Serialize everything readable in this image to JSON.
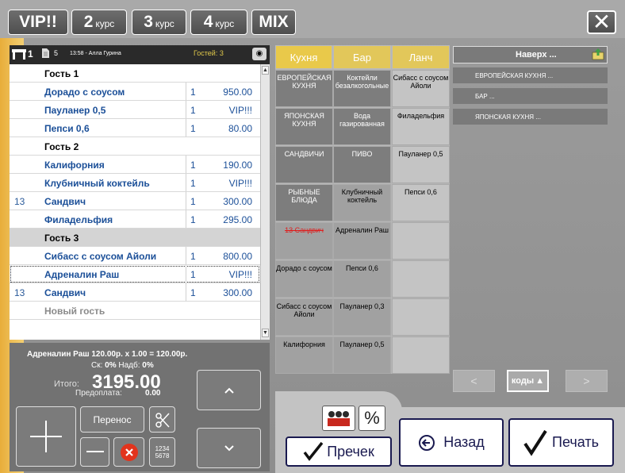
{
  "topbar": {
    "buttons": [
      {
        "big": "VIP!!",
        "small": ""
      },
      {
        "big": "2",
        "small": "курс"
      },
      {
        "big": "3",
        "small": "курс"
      },
      {
        "big": "4",
        "small": "курс"
      },
      {
        "big": "MIX",
        "small": ""
      }
    ],
    "close_label": "✕"
  },
  "order_header": {
    "table": "1",
    "order_count": "5",
    "time_waiter": "13:58 - Алла Гурина",
    "guests": "Гостей: 3"
  },
  "order_rows": [
    {
      "num": "",
      "name": "Гость 1",
      "qty": "",
      "price": "",
      "kind": "guest"
    },
    {
      "num": "",
      "name": "Дорадо с соусом",
      "qty": "1",
      "price": "950.00",
      "kind": "item"
    },
    {
      "num": "",
      "name": "Пауланер 0,5",
      "qty": "1",
      "price": "VIP!!!",
      "kind": "item"
    },
    {
      "num": "",
      "name": "Пепси 0,6",
      "qty": "1",
      "price": "80.00",
      "kind": "item"
    },
    {
      "num": "",
      "name": "Гость 2",
      "qty": "",
      "price": "",
      "kind": "guest"
    },
    {
      "num": "",
      "name": "Калифорния",
      "qty": "1",
      "price": "190.00",
      "kind": "item"
    },
    {
      "num": "",
      "name": "Клубничный коктейль",
      "qty": "1",
      "price": "VIP!!!",
      "kind": "item"
    },
    {
      "num": "13",
      "name": "Сандвич",
      "qty": "1",
      "price": "300.00",
      "kind": "item"
    },
    {
      "num": "",
      "name": "Филадельфия",
      "qty": "1",
      "price": "295.00",
      "kind": "item"
    },
    {
      "num": "",
      "name": "Гость 3",
      "qty": "",
      "price": "",
      "kind": "guestgray"
    },
    {
      "num": "",
      "name": "Сибасс с соусом Айоли",
      "qty": "1",
      "price": "800.00",
      "kind": "item"
    },
    {
      "num": "",
      "name": "Адреналин Раш",
      "qty": "1",
      "price": "VIP!!!",
      "kind": "sel"
    },
    {
      "num": "13",
      "name": "Сандвич",
      "qty": "1",
      "price": "300.00",
      "kind": "item"
    },
    {
      "num": "",
      "name": "Новый гость",
      "qty": "",
      "price": "",
      "kind": "newguest"
    }
  ],
  "summary": {
    "line": "Адреналин Раш 120.00р. x 1.00 = 120.00р.",
    "discount_label": "Ск:",
    "discount_value": "0%",
    "markup_label": "Надб:",
    "markup_value": "0%",
    "total_label": "Итого:",
    "total_value": "3195.00",
    "prepay_label": "Предоплата:",
    "prepay_value": "0.00"
  },
  "left_controls": {
    "transfer": "Перенос",
    "keypad_top": "1234",
    "keypad_bottom": "5678"
  },
  "categories": [
    "Кухня",
    "Бар",
    "Ланч"
  ],
  "grid_columns": [
    [
      "ЕВРОПЕЙСКАЯ КУХНЯ",
      "ЯПОНСКАЯ КУХНЯ",
      "САНДВИЧИ",
      "РЫБНЫЕ БЛЮДА",
      "13  Сандвич",
      "Дорадо с соусом",
      "Сибасс с соусом Айоли",
      "Калифорния"
    ],
    [
      "Коктейли безалкогольные",
      "Вода газированная",
      "ПИВО",
      "Клубничный коктейль",
      "Адреналин Раш",
      "Пепси 0,6",
      "Пауланер 0,3",
      "Пауланер 0,5"
    ],
    [
      "Сибасс с соусом Айоли",
      "Филадельфия",
      "Пауланер 0,5",
      "Пепси 0,6",
      "",
      "",
      "",
      ""
    ]
  ],
  "right_panel": {
    "up_label": "Наверх ...",
    "links": [
      "ЕВРОПЕЙСКАЯ КУХНЯ ...",
      "БАР ...",
      "ЯПОНСКАЯ КУХНЯ ..."
    ],
    "prev": "<",
    "next": ">",
    "codes": "коды"
  },
  "actions": {
    "precheck": "Пречек",
    "back": "Назад",
    "print": "Печать",
    "percent": "%"
  }
}
